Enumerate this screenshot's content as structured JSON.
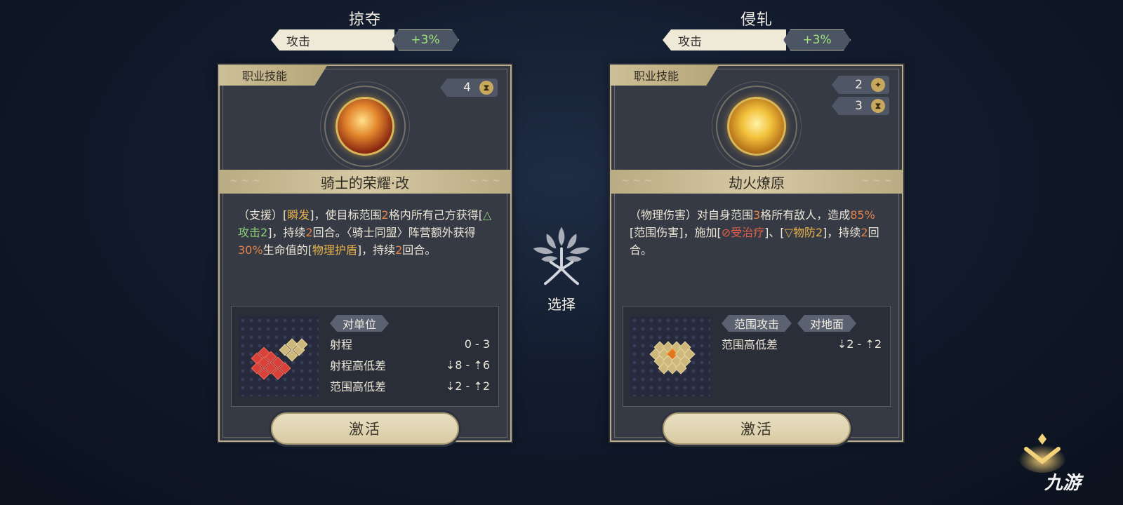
{
  "left": {
    "path_title": "掠夺",
    "attr_label": "攻击",
    "attr_value": "+3%",
    "tag": "职业技能",
    "cooldown": "4",
    "skill_name": "骑士的荣耀·改",
    "desc": {
      "p1": "（支援）[",
      "k1": "瞬发",
      "p2": "]，使目标范围",
      "n1": "2",
      "p3": "格内所有己方获得[",
      "k2": "△攻击2",
      "p4": "]，持续",
      "n2": "2",
      "p5": "回合。〈骑士同盟〉阵营额外获得",
      "n3": "30%",
      "p6": "生命值的[",
      "k3": "物理护盾",
      "p7": "]，持续",
      "n4": "2",
      "p8": "回合。"
    },
    "chips": [
      "对单位"
    ],
    "stats": [
      {
        "label": "射程",
        "value": "0 - 3"
      },
      {
        "label": "射程高低差",
        "value": "⇣8 - ⇡6"
      },
      {
        "label": "范围高低差",
        "value": "⇣2 - ⇡2"
      }
    ],
    "activate": "激活"
  },
  "right": {
    "path_title": "侵轧",
    "attr_label": "攻击",
    "attr_value": "+3%",
    "tag": "职业技能",
    "charges": "2",
    "cooldown": "3",
    "skill_name": "劫火燎原",
    "desc": {
      "p1": "（物理伤害）对自身范围",
      "n1": "3",
      "p2": "格所有敌人，造成",
      "n2": "85%",
      "p3": "[范围伤害]，施加[",
      "k1": "⊘受治疗",
      "p4": "]、[",
      "k2": "▽物防2",
      "p5": "]，持续",
      "n3": "2",
      "p6": "回合。"
    },
    "chips": [
      "范围攻击",
      "对地面"
    ],
    "stats": [
      {
        "label": "范围高低差",
        "value": "⇣2 - ⇡2"
      }
    ],
    "activate": "激活"
  },
  "center": {
    "select_label": "选择"
  },
  "watermark": "九游",
  "colors": {
    "highlight_number": "#e3834a",
    "highlight_keyword": "#e9b54a",
    "buff_green": "#8fd27a",
    "debuff_red": "#e5604a",
    "attr_positive": "#9fe37a"
  },
  "icons": [
    "hourglass-icon",
    "star-charge-icon",
    "tree-emblem-icon",
    "chevron-up-icon"
  ]
}
